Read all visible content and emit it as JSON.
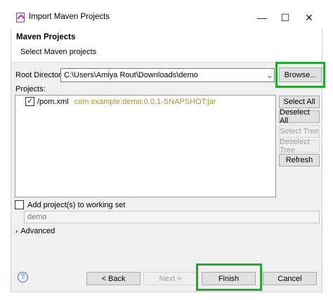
{
  "window": {
    "title": "Import Maven Projects",
    "minimize_glyph": "—",
    "maximize_glyph": "☐",
    "close_glyph": "✕"
  },
  "header": {
    "title": "Maven Projects",
    "subtitle": "Select Maven projects"
  },
  "root_directory": {
    "label": "Root Directory:",
    "value": "C:\\Users\\Amiya Rout\\Downloads\\demo",
    "dropdown_glyph": "⌄",
    "browse_label": "Browse..."
  },
  "projects": {
    "label": "Projects:",
    "items": [
      {
        "checked": true,
        "name": "/pom.xml",
        "artifact": "com.example:demo:0.0.1-SNAPSHOT:jar"
      }
    ]
  },
  "side_buttons": {
    "select_all": "Select All",
    "deselect_all": "Deselect All",
    "select_tree": "Select Tree",
    "deselect_tree": "Deselect Tree",
    "refresh": "Refresh"
  },
  "working_set": {
    "checkbox_label": "Add project(s) to working set",
    "value": "demo"
  },
  "advanced": {
    "label": "Advanced",
    "glyph": "›"
  },
  "footer": {
    "help_glyph": "?",
    "back_label": "< Back",
    "next_label": "Next >",
    "finish_label": "Finish",
    "cancel_label": "Cancel"
  },
  "colors": {
    "highlight": "#26a533",
    "dialog_bg": "#f0f0f0"
  }
}
